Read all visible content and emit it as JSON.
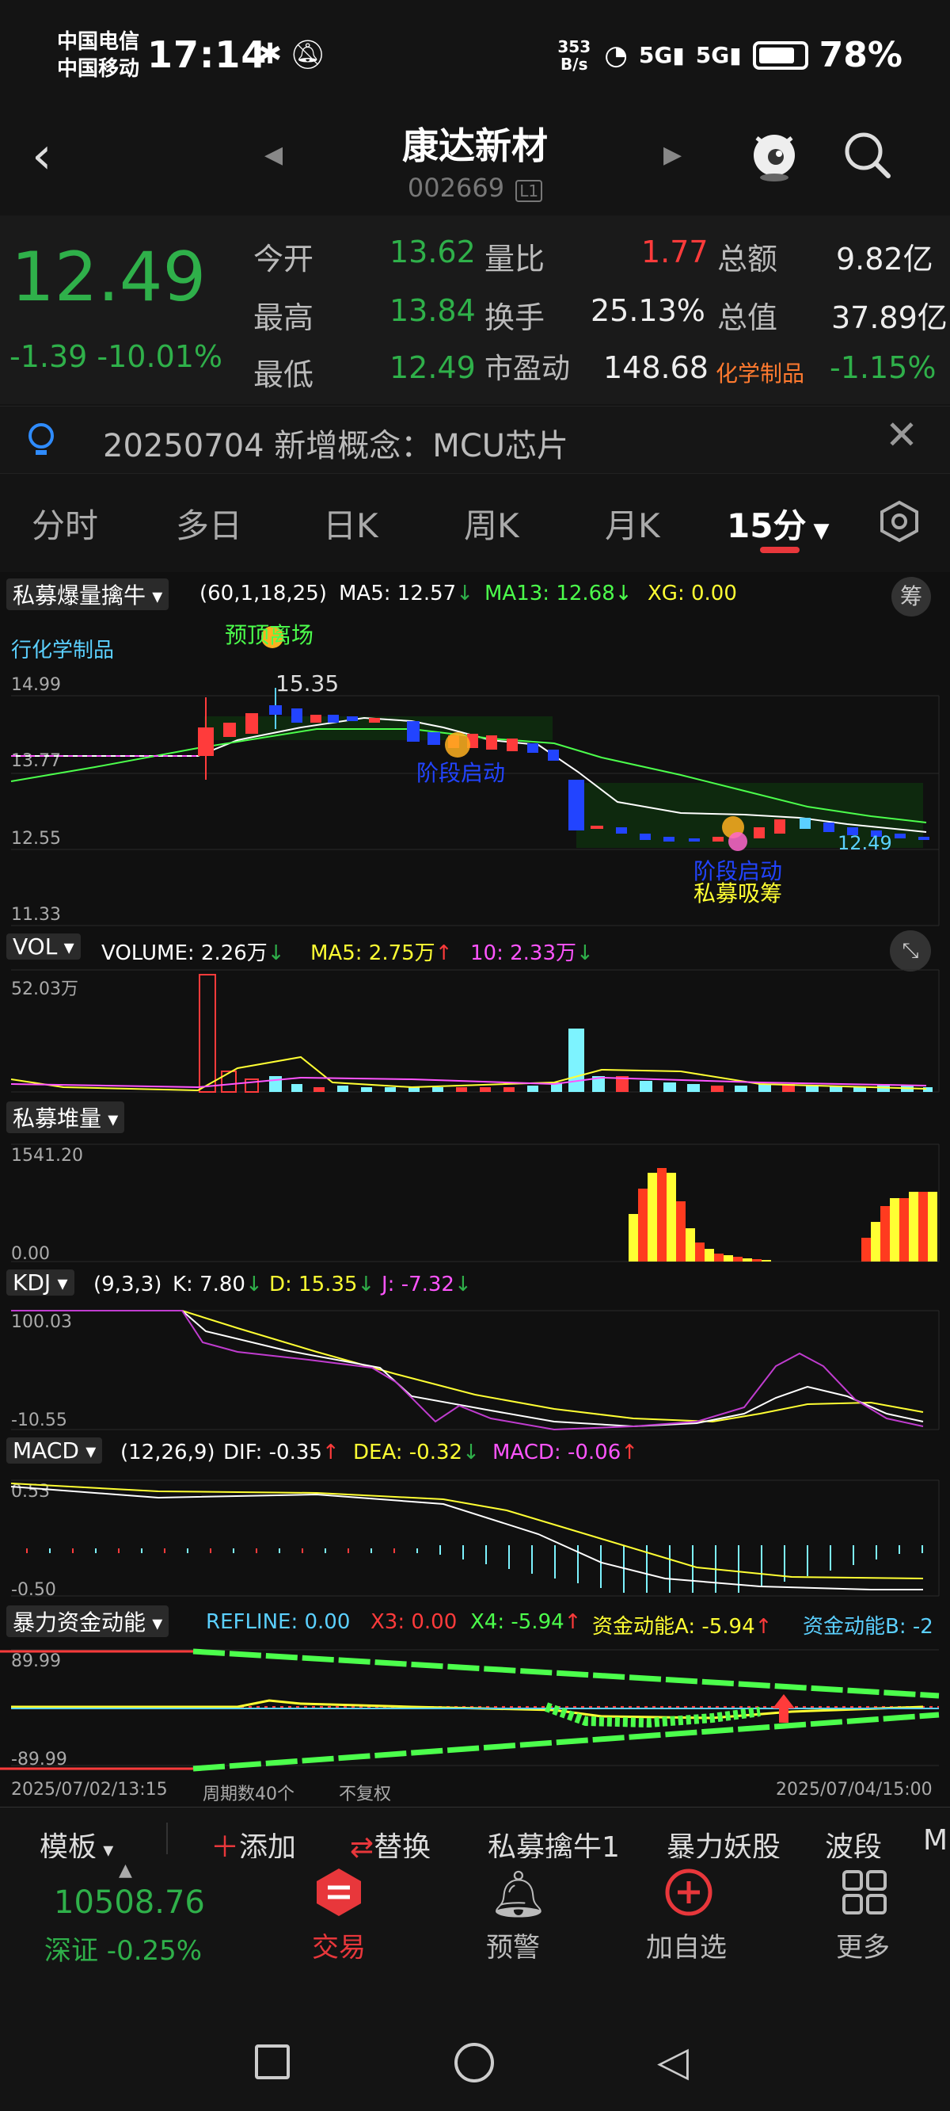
{
  "status_bar": {
    "carrier1": "中国电信",
    "carrier2": "中国移动",
    "time": "17:14",
    "speed": "353 B/s",
    "battery": "78%"
  },
  "header": {
    "stock_name": "康达新材",
    "stock_code": "002669",
    "level": "L1"
  },
  "quote": {
    "price": "12.49",
    "change": "-1.39",
    "change_pct": "-10.01%",
    "open_label": "今开",
    "open": "13.62",
    "high_label": "最高",
    "high": "13.84",
    "low_label": "最低",
    "low": "12.49",
    "vol_ratio_label": "量比",
    "vol_ratio": "1.77",
    "turnover_label": "换手",
    "turnover": "25.13%",
    "pe_label": "市盈动",
    "pe": "148.68",
    "amount_label": "总额",
    "amount": "9.82亿",
    "mktcap_label": "总值",
    "mktcap": "37.89亿",
    "sector": "化学制品",
    "sector_chg": "-1.15%"
  },
  "notice": "20250704 新增概念：MCU芯片",
  "tabs": [
    "分时",
    "多日",
    "日K",
    "周K",
    "月K",
    "15分"
  ],
  "main_chart": {
    "name": "私募爆量擒牛",
    "params": "(60,1,18,25)",
    "ma5": "MA5: 12.57",
    "ma13": "MA13: 12.68",
    "xg": "XG: 0.00",
    "chip_btn": "筹",
    "sector_tag": "行化学制品",
    "label_top": "预顶离场",
    "label_max": "15.35",
    "label_mid": "阶段启动",
    "label_low_start": "阶段启动",
    "label_low_accum": "私募吸筹",
    "last_price": "12.49",
    "yticks": [
      "14.99",
      "13.77",
      "12.55",
      "11.33"
    ]
  },
  "vol": {
    "name": "VOL",
    "volume": "VOLUME: 2.26万",
    "ma5": "MA5: 2.75万",
    "ma10": "10: 2.33万",
    "ymax": "52.03万"
  },
  "pile": {
    "name": "私募堆量",
    "ymax": "1541.20",
    "ymin": "0.00"
  },
  "kdj": {
    "name": "KDJ",
    "params": "(9,3,3)",
    "k": "K: 7.80",
    "d": "D: 15.35",
    "j": "J: -7.32",
    "ymax": "100.03",
    "ymin": "-10.55"
  },
  "macd": {
    "name": "MACD",
    "params": "(12,26,9)",
    "dif": "DIF: -0.35",
    "dea": "DEA: -0.32",
    "macd": "MACD: -0.06",
    "ymax": "0.53",
    "ymin": "-0.50"
  },
  "force": {
    "name": "暴力资金动能",
    "refline": "REFLINE: 0.00",
    "x3": "X3: 0.00",
    "x4": "X4: -5.94",
    "a": "资金动能A: -5.94",
    "b": "资金动能B: -2",
    "ymax": "89.99",
    "ymin": "-89.99"
  },
  "time_axis": {
    "start": "2025/07/02/13:15",
    "periods": "周期数40个",
    "adjust": "不复权",
    "end": "2025/07/04/15:00"
  },
  "toolbar": [
    "模板",
    "添加",
    "替换",
    "私募擒牛1",
    "暴力妖股",
    "波段",
    "M"
  ],
  "dock": {
    "index_value": "10508.76",
    "index_name": "深证 -0.25%",
    "items": [
      "交易",
      "预警",
      "加自选",
      "更多"
    ]
  },
  "colors": {
    "up": "#ff3b3b",
    "down": "#2fb04a",
    "accent": "#e8373b"
  }
}
